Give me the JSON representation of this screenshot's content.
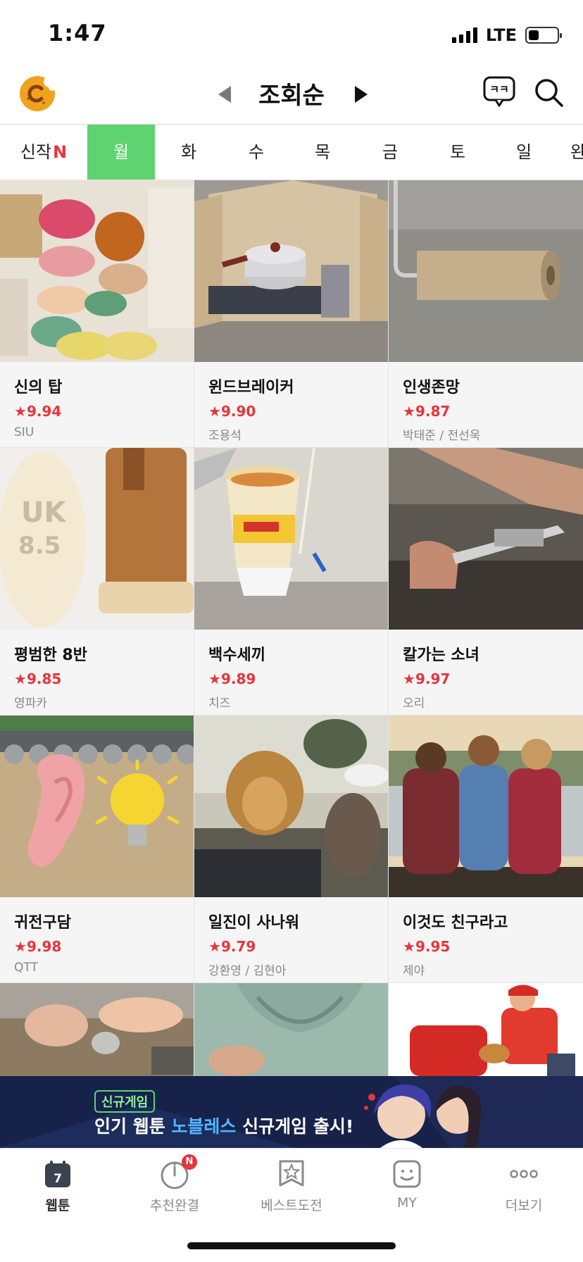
{
  "status_bar": {
    "time": "1:47",
    "network": "LTE",
    "battery_level": 0.35
  },
  "header": {
    "sort_title": "조회순",
    "icons": [
      "logo-icon",
      "chevron-left-icon",
      "chevron-right-icon",
      "chat-icon",
      "search-icon"
    ],
    "chat_icon_text": "ㅋㅋ"
  },
  "tabs": [
    {
      "label": "신작",
      "badge": "N"
    },
    {
      "label": "월"
    },
    {
      "label": "화"
    },
    {
      "label": "수"
    },
    {
      "label": "목"
    },
    {
      "label": "금"
    },
    {
      "label": "토"
    },
    {
      "label": "일"
    },
    {
      "label": "완"
    }
  ],
  "active_tab_index": 1,
  "colors": {
    "accent": "#5fd36f",
    "rating": "#e8343b",
    "banner_bg": "#16224a"
  },
  "webtoons": [
    {
      "title": "신의 탑",
      "rating": "9.94",
      "author": "SIU"
    },
    {
      "title": "윈드브레이커",
      "rating": "9.90",
      "author": "조용석"
    },
    {
      "title": "인생존망",
      "rating": "9.87",
      "author": "박태준 / 전선욱"
    },
    {
      "title": "평범한 8반",
      "rating": "9.85",
      "author": "영파카",
      "thumb_text_1": "UK",
      "thumb_text_2": "8.5"
    },
    {
      "title": "백수세끼",
      "rating": "9.89",
      "author": "치즈"
    },
    {
      "title": "칼가는 소녀",
      "rating": "9.97",
      "author": "오리"
    },
    {
      "title": "귀전구담",
      "rating": "9.98",
      "author": "QTT"
    },
    {
      "title": "일진이 사나워",
      "rating": "9.79",
      "author": "강환영 / 김현아"
    },
    {
      "title": "이것도 친구라고",
      "rating": "9.95",
      "author": "제야"
    }
  ],
  "rating_star": "★",
  "banner": {
    "tag": "신규게임",
    "text_before": "인기 웹툰 ",
    "text_highlight": "노블레스",
    "text_after": " 신규게임 출시!"
  },
  "bottom_nav": [
    {
      "label": "웹툰",
      "icon": "calendar-icon",
      "icon_text": "7",
      "active": true
    },
    {
      "label": "추천완결",
      "icon": "clock-icon",
      "badge": "N"
    },
    {
      "label": "베스트도전",
      "icon": "bookmark-star-icon"
    },
    {
      "label": "MY",
      "icon": "smile-face-icon"
    },
    {
      "label": "더보기",
      "icon": "more-dots-icon"
    }
  ]
}
